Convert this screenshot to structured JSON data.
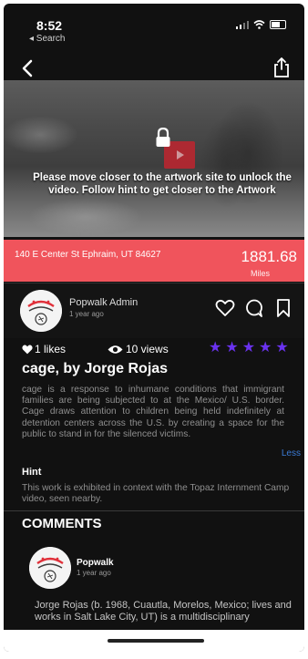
{
  "status_bar": {
    "time": "8:52",
    "back_app": "◂ Search"
  },
  "video": {
    "unlock_message": "Please move closer to the artwork site to unlock the video. Follow hint to get closer to the Artwork"
  },
  "location": {
    "address": "140 E Center St   Ephraim, UT 84627",
    "distance": "1881.68",
    "unit": "Miles"
  },
  "author": {
    "name": "Popwalk Admin",
    "time_ago": "1 year ago"
  },
  "stats": {
    "likes": "1 likes",
    "views": "10 views",
    "rating": 5
  },
  "artwork": {
    "title": "cage, by Jorge Rojas",
    "description": "cage is a response to inhumane conditions that immigrant families are being subjected to at the Mexico/ U.S. border. Cage draws attention to children being held indefinitely at detention centers across the U.S. by creating a space for the public to stand in for the silenced victims.",
    "less_label": "Less",
    "hint_label": "Hint",
    "hint_text": "This work is exhibited in context with the Topaz Internment Camp video, seen nearby."
  },
  "comments": {
    "title": "COMMENTS",
    "items": [
      {
        "user": "Popwalk",
        "time_ago": "1 year ago",
        "text": "Jorge Rojas (b. 1968, Cuautla, Morelos, Mexico; lives and works in Salt Lake City, UT) is a multidisciplinary"
      }
    ]
  },
  "colors": {
    "accent_red": "#f0545c",
    "star_purple": "#6a32f0",
    "background": "#111111"
  }
}
